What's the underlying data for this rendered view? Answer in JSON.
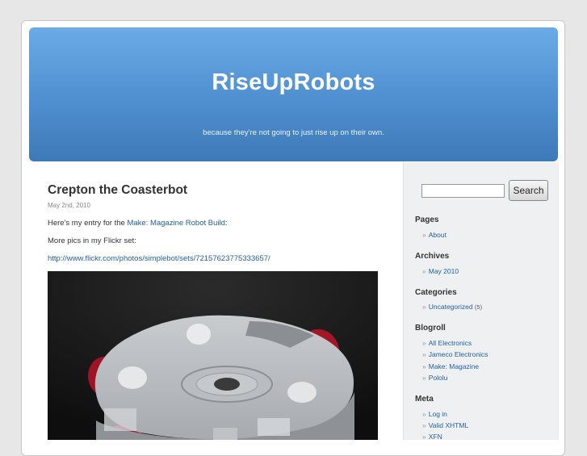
{
  "blog": {
    "title": "RiseUpRobots",
    "tagline": "because they're not going to just rise up on their own."
  },
  "post": {
    "title": "Crepton the Coasterbot",
    "date": "May 2nd, 2010",
    "entry_text": "Here's my entry for the ",
    "entry_link": "Make: Magazine Robot Build",
    "entry_suffix": ":",
    "more_pics": "More pics in my Flickr set:",
    "flickr_url": "http://www.flickr.com/photos/simplebot/sets/72157623775333657/"
  },
  "search": {
    "button_label": "Search",
    "value": ""
  },
  "sidebar": {
    "pages": {
      "heading": "Pages",
      "items": [
        "About"
      ]
    },
    "archives": {
      "heading": "Archives",
      "items": [
        "May 2010"
      ]
    },
    "categories": {
      "heading": "Categories",
      "items": [
        {
          "label": "Uncategorized",
          "count": "(5)"
        }
      ]
    },
    "blogroll": {
      "heading": "Blogroll",
      "items": [
        "All Electronics",
        "Jameco Electronics",
        "Make: Magazine",
        "Pololu"
      ]
    },
    "meta": {
      "heading": "Meta",
      "items": [
        "Log in",
        "Valid XHTML",
        "XFN"
      ]
    },
    "bullet": "»"
  },
  "colors": {
    "header_top": "#6aabe6",
    "header_bottom": "#3e79b8",
    "link": "#2361a1",
    "sidebar_bg": "#eef0f2"
  }
}
